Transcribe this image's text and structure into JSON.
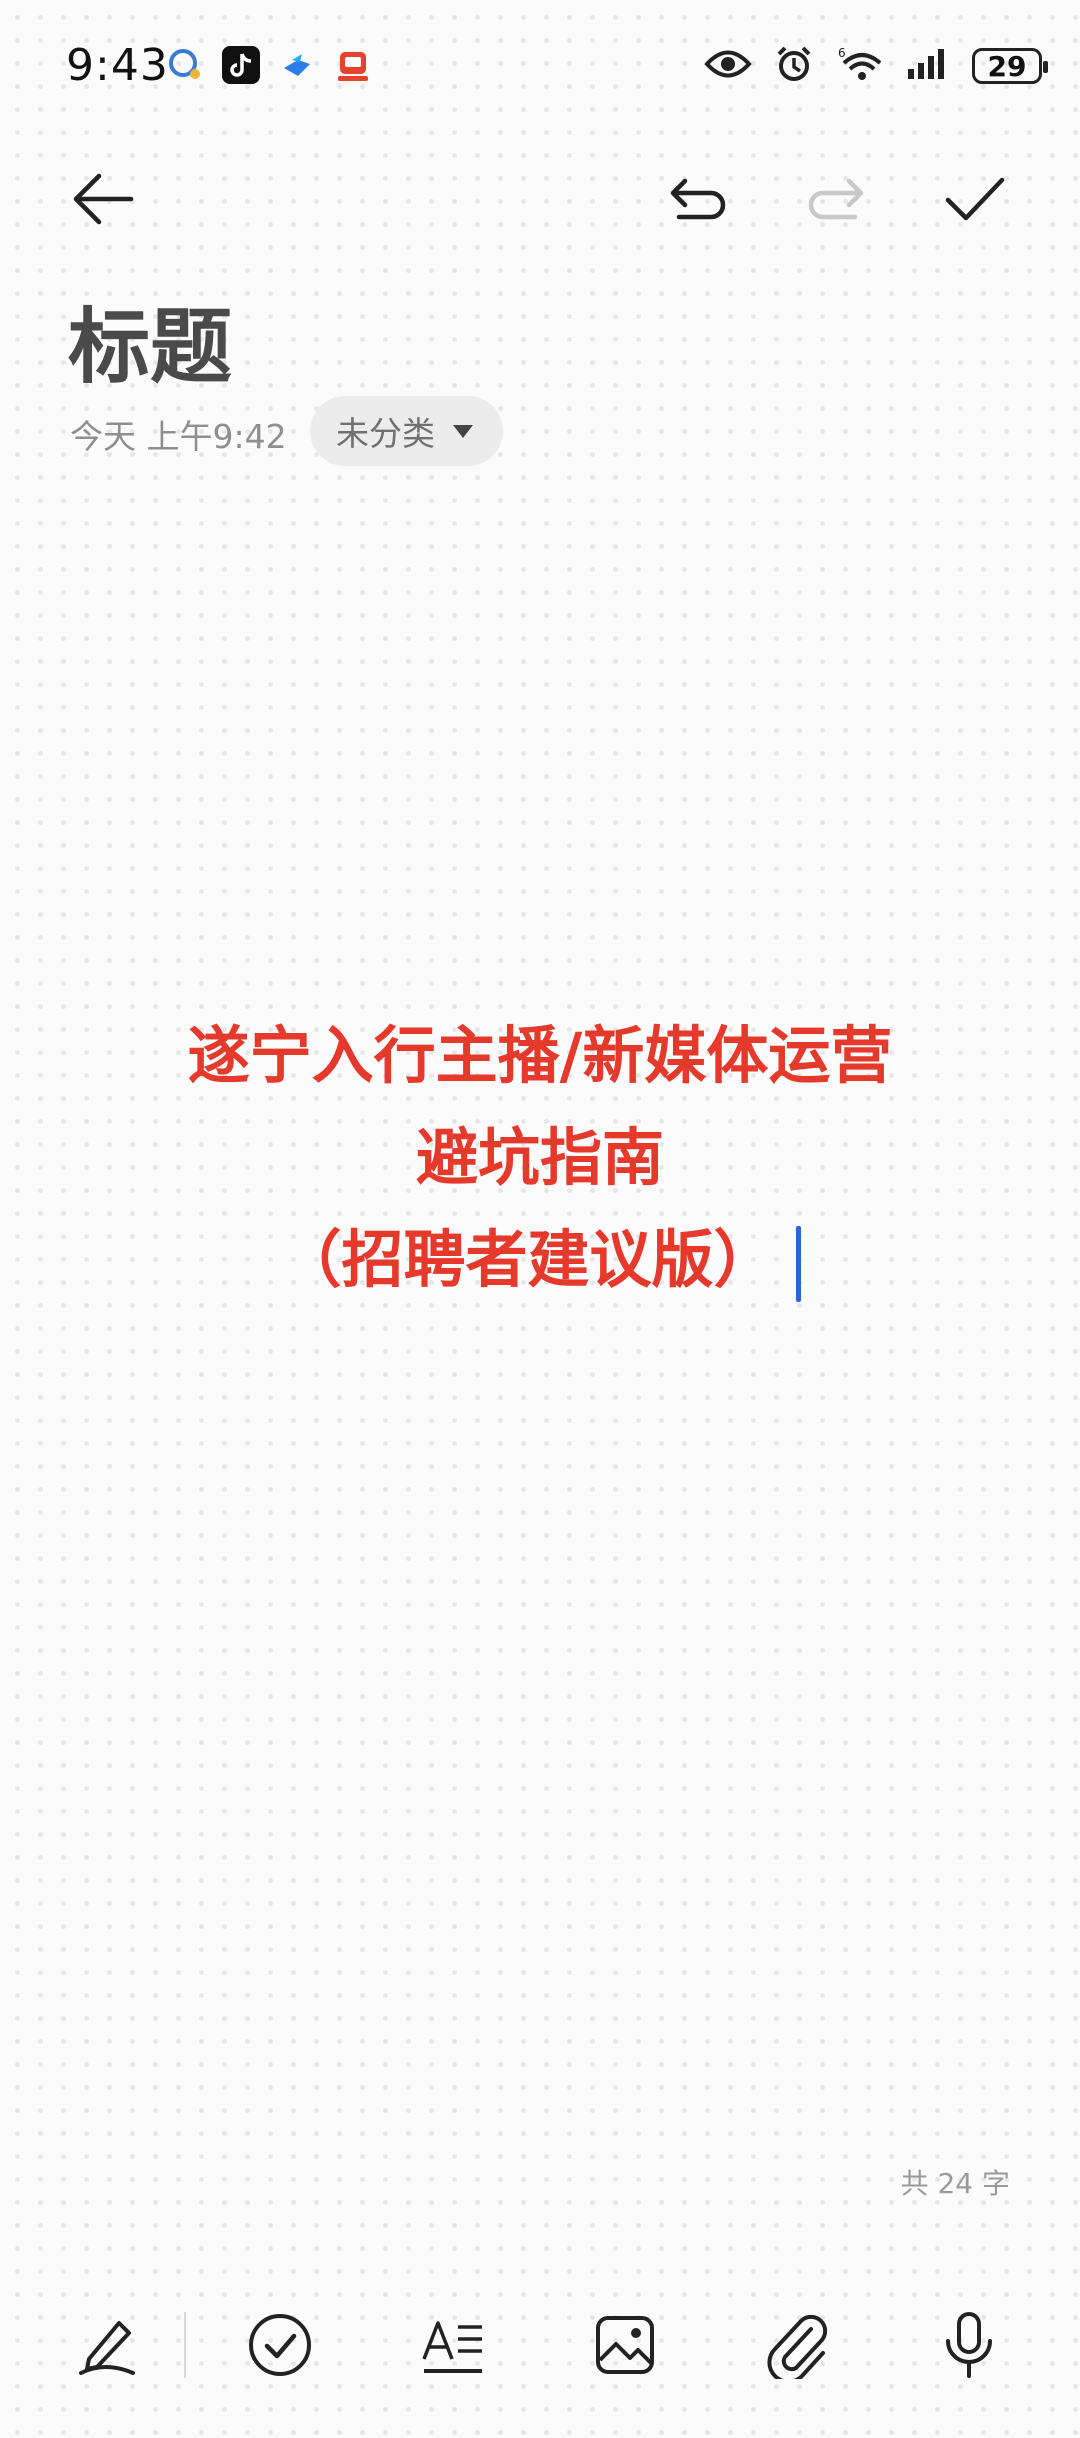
{
  "status_bar": {
    "time": "9:43",
    "battery_level": "29",
    "notification_icons": [
      "chat-bubble-icon",
      "tiktok-icon",
      "bird-app-icon",
      "delivery-app-icon"
    ],
    "system_icons": [
      "eye-icon",
      "alarm-icon",
      "wifi-6-icon",
      "signal-icon",
      "battery-icon"
    ]
  },
  "toolbar": {
    "back": "arrow-left-icon",
    "undo": "undo-icon",
    "redo": "redo-icon",
    "confirm": "check-icon"
  },
  "note": {
    "title": "标题",
    "date": "今天 上午9:42",
    "category": "未分类",
    "body_lines": [
      "遂宁入行主播/新媒体运营",
      "避坑指南",
      "（招聘者建议版）"
    ],
    "word_count": "共 24 字"
  },
  "bottom_toolbar": {
    "items": [
      "handwriting-pen-icon",
      "checklist-icon",
      "text-format-icon",
      "image-icon",
      "attachment-icon",
      "microphone-icon"
    ]
  },
  "colors": {
    "body_text": "#e5392c",
    "cursor": "#2f63d8",
    "background": "#fbfbfb"
  }
}
